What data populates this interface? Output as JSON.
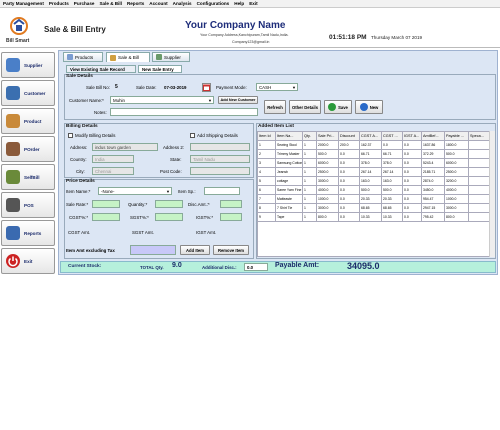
{
  "menu": [
    "Party Management",
    "Products",
    "Purchase",
    "Sale & Bill",
    "Reports",
    "Account",
    "Analysis",
    "Configurations",
    "Help",
    "Exit"
  ],
  "header": {
    "app_name": "Bill Smart",
    "screen_title": "Sale & Bill Entry",
    "company_name": "Your Company Name",
    "company_address": "Your Company Address,Kanchipuram,Tamil Nadu,India.",
    "company_email": "Company123@gmail.in",
    "time": "01:51:18 PM",
    "date": "Thursday   March 07 2019"
  },
  "sidebar": [
    {
      "label": "Supplier",
      "icon": "supplier-icon",
      "color": "#4a7fc8"
    },
    {
      "label": "Customer",
      "icon": "customer-icon",
      "color": "#3b6fb0"
    },
    {
      "label": "Product",
      "icon": "product-icon",
      "color": "#c98a3a"
    },
    {
      "label": "POrder",
      "icon": "porder-icon",
      "color": "#8a5a3a"
    },
    {
      "label": "SelfBill",
      "icon": "selfbill-icon",
      "color": "#6a8a3a"
    },
    {
      "label": "POS",
      "icon": "pos-icon",
      "color": "#555555"
    },
    {
      "label": "Reports",
      "icon": "reports-icon",
      "color": "#3a6ab0"
    },
    {
      "label": "Exit",
      "icon": "exit-icon",
      "color": "#cc2222"
    }
  ],
  "tabs": [
    "Products",
    "Sale & Bill",
    "Supplier"
  ],
  "subtabs": [
    "View Existing Sale Record",
    "New Sale Entry"
  ],
  "sale_details": {
    "title": "Sale Details",
    "bill_no_label": "Sale Bill No:",
    "bill_no": "5",
    "sale_date_label": "Sale Date:",
    "sale_date": "07-03-2019",
    "payment_mode_label": "Payment Mode:",
    "payment_mode": "CASH",
    "customer_label": "Customer Name:*",
    "customer": "Muhin",
    "add_customer": "Add New Customer",
    "notes_label": "Notes:",
    "refresh": "Refresh",
    "other_details": "Other Details",
    "save": "Save",
    "new": "New"
  },
  "billing": {
    "title": "Billing Details",
    "modify": "Modify Billing Details",
    "add_shipping": "Add Shipping Details",
    "address_label": "Address:",
    "address": "indus town garden",
    "address2_label": "Address 2:",
    "country_label": "Country:",
    "country": "India",
    "state_label": "State:",
    "state": "Tamil Nadu",
    "city_label": "City:",
    "city": "Chennai",
    "postcode_label": "Post Code:"
  },
  "price": {
    "title": "Price Details",
    "item_name_label": "Item Name:*",
    "item_name": "-None-",
    "item_sp_label": "Item Sp.:",
    "sale_rate_label": "Sale Rate:*",
    "quantity_label": "Quantity:*",
    "disc_label": "Disc.Amt.:*",
    "cgst_pct_label": "CGST%:*",
    "sgst_pct_label": "SGST%:*",
    "igst_pct_label": "IGST%:*",
    "cgst_amt_label": "CGST Amt.",
    "sgst_amt_label": "SGST Amt.",
    "igst_amt_label": "IGST Amt.",
    "excl_tax_label": "Item Amt excluding Tax",
    "add_item": "Add Item",
    "remove_item": "Remove Item"
  },
  "items_table": {
    "title": "Added Item List",
    "columns": [
      "Item Id",
      "Item Na...",
      "Qty.",
      "Sale Pri...",
      "Discount",
      "CGST A...",
      "CGST ...",
      "IGST A...",
      "AmtBef...",
      "Payable ...",
      "Speca..."
    ],
    "rows": [
      [
        "1",
        "Sewing Stool",
        "1",
        "2000.0",
        "200.0",
        "162.37",
        "0.0",
        "0.0",
        "1637.86",
        "1800.0",
        ""
      ],
      [
        "2",
        "Trimmy Master",
        "1",
        "500.0",
        "0.0",
        "66.71",
        "66.71",
        "0.0",
        "372.29",
        "500.0",
        ""
      ],
      [
        "3",
        "Samsung Cotton",
        "1",
        "6000.0",
        "0.0",
        "378.0",
        "378.0",
        "0.0",
        "5243.4",
        "6000.0",
        ""
      ],
      [
        "4",
        "Jeansb",
        "1",
        "2500.0",
        "0.0",
        "267.14",
        "267.14",
        "0.0",
        "2185.71",
        "2500.0",
        ""
      ],
      [
        "5",
        "cottage",
        "1",
        "3000.0",
        "0.0",
        "163.0",
        "163.0",
        "0.0",
        "2874.0",
        "3200.0",
        ""
      ],
      [
        "6",
        "Saree Yarn Fine",
        "1",
        "4000.0",
        "0.0",
        "500.0",
        "500.0",
        "0.0",
        "3450.0",
        "4000.0",
        ""
      ],
      [
        "7",
        "Matteaste",
        "1",
        "1000.0",
        "0.0",
        "20.33",
        "20.33",
        "0.0",
        "954.47",
        "1000.0",
        ""
      ],
      [
        "8",
        "7 Shirt Tie",
        "1",
        "3000.0",
        "0.0",
        "68.65",
        "68.65",
        "0.0",
        "2947.15",
        "3000.0",
        ""
      ],
      [
        "9",
        "Tape",
        "1",
        "800.0",
        "0.0",
        "10.33",
        "10.33",
        "0.0",
        "795.42",
        "800.0",
        ""
      ]
    ]
  },
  "status": {
    "current_stock": "Current Stock:",
    "total_qty_label": "TOTAL Qty.",
    "total_qty": "9.0",
    "add_disc_label": "Additional Disc.:",
    "add_disc": "0.0",
    "payable_label": "Payable Amt:",
    "payable": "34095.0"
  }
}
